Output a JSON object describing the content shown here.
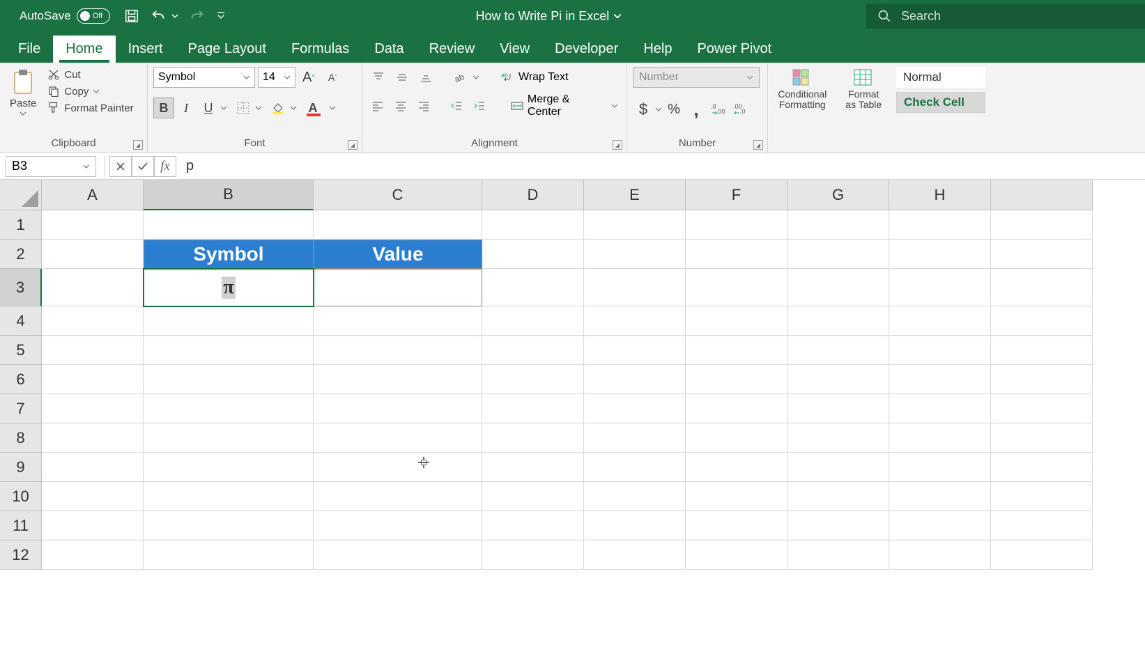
{
  "title_bar": {
    "autosave_label": "AutoSave",
    "autosave_state": "Off",
    "document_title": "How to Write Pi in Excel",
    "search_placeholder": "Search"
  },
  "ribbon_tabs": [
    "File",
    "Home",
    "Insert",
    "Page Layout",
    "Formulas",
    "Data",
    "Review",
    "View",
    "Developer",
    "Help",
    "Power Pivot"
  ],
  "active_tab": "Home",
  "clipboard": {
    "paste": "Paste",
    "cut": "Cut",
    "copy": "Copy",
    "format_painter": "Format Painter",
    "group_label": "Clipboard"
  },
  "font": {
    "name": "Symbol",
    "size": "14",
    "group_label": "Font"
  },
  "alignment": {
    "wrap_text": "Wrap Text",
    "merge_center": "Merge & Center",
    "group_label": "Alignment"
  },
  "number": {
    "format": "Number",
    "group_label": "Number"
  },
  "styles": {
    "conditional": "Conditional Formatting",
    "format_as_table": "Format as Table",
    "normal": "Normal",
    "check_cell": "Check Cell"
  },
  "formula_bar": {
    "name_box": "B3",
    "formula": "p"
  },
  "columns": [
    "A",
    "B",
    "C",
    "D",
    "E",
    "F",
    "G",
    "H"
  ],
  "rows": [
    "1",
    "2",
    "3",
    "4",
    "5",
    "6",
    "7",
    "8",
    "9",
    "10",
    "11",
    "12"
  ],
  "sheet": {
    "B2": "Symbol",
    "C2": "Value",
    "B3": "π"
  },
  "selected_cell": "B3",
  "chart_data": {
    "type": "table",
    "headers": [
      "Symbol",
      "Value"
    ],
    "rows": [
      [
        "π",
        ""
      ]
    ]
  }
}
